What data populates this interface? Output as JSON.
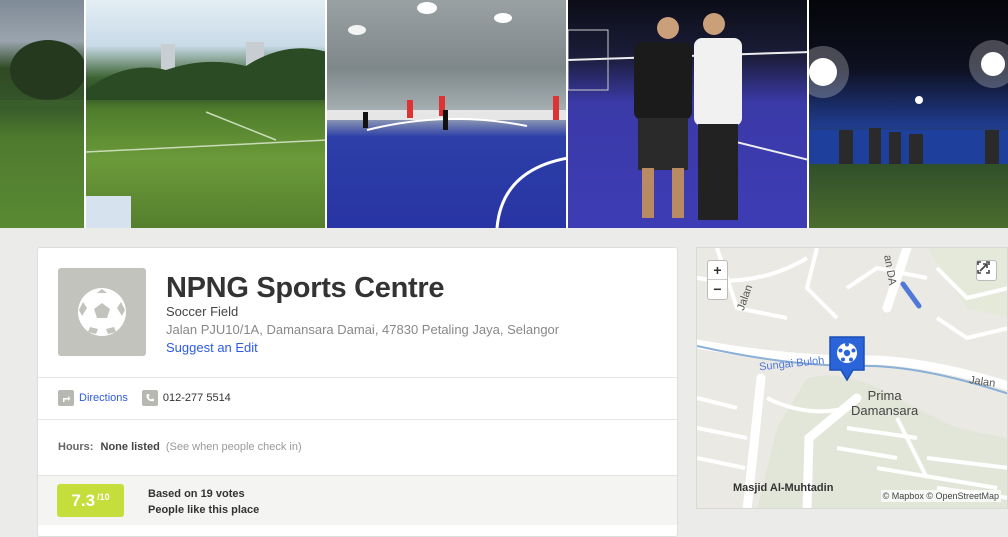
{
  "photos": [
    "photo-field-1",
    "photo-field-2",
    "photo-indoor-futsal",
    "photo-two-players",
    "photo-night-field"
  ],
  "venue": {
    "name": "NPNG Sports Centre",
    "category": "Soccer Field",
    "address": "Jalan PJU10/1A, Damansara Damai, 47830 Petaling Jaya, Selangor",
    "suggest_edit": "Suggest an Edit"
  },
  "contact": {
    "directions_label": "Directions",
    "phone": "012-277 5514"
  },
  "hours": {
    "label": "Hours:",
    "value": "None listed",
    "hint": "(See when people check in)"
  },
  "rating": {
    "score": "7.3",
    "out_of": "/10",
    "votes_text": "Based on 19 votes",
    "likes_text": "People like this place",
    "color": "#c5de3b"
  },
  "map": {
    "zoom_in": "+",
    "zoom_out": "−",
    "labels": {
      "jalan_top": "Jalan",
      "jalan_da": "an DA",
      "sungai": "Sungai Buloh",
      "jalan_right": "Jalan",
      "prima": "Prima",
      "damansara": "Damansara",
      "masjid": "Masjid Al-Muhtadin"
    },
    "attribution": "© Mapbox © OpenStreetMap",
    "pin_color": "#2a64d8"
  },
  "icons": {
    "venue": "soccer-ball-icon",
    "directions": "directions-icon",
    "phone": "phone-icon",
    "expand": "expand-icon"
  }
}
